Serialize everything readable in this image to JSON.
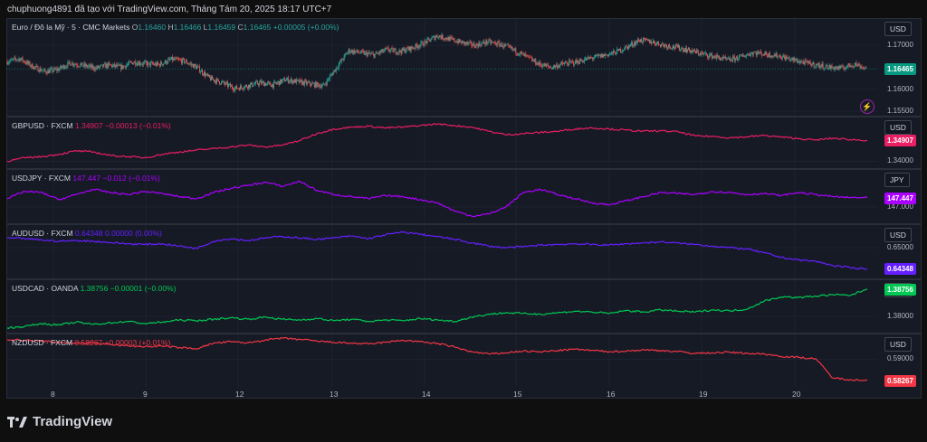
{
  "header": {
    "text": "chuphuong4891 đã tạo với TradingView.com, Tháng Tám 20, 2025 18:17 UTC+7"
  },
  "brand": {
    "name": "TradingView",
    "icon": "tradingview-logo-icon"
  },
  "colors": {
    "up": "#26a69a",
    "down": "#ef5350"
  },
  "x_axis": {
    "labels": [
      "8",
      "9",
      "12",
      "13",
      "14",
      "15",
      "16",
      "19",
      "20"
    ]
  },
  "chart_data": [
    {
      "type": "candlestick",
      "symbol": "Euro / Đô la Mỹ · 5 · CMC Markets",
      "ohlc": {
        "O": "1.16460",
        "H": "1.16466",
        "L": "1.16459",
        "C": "1.16465",
        "change": "+0.00005 (+0.00%)"
      },
      "currency": "USD",
      "last_price": "1.16465",
      "last_price_color": "#089981",
      "yticks": [
        "1.17000",
        "1.16000",
        "1.15500"
      ],
      "ylim": [
        1.154,
        1.176
      ],
      "points": [
        1.1663,
        1.167,
        1.1652,
        1.164,
        1.1645,
        1.166,
        1.1654,
        1.1648,
        1.1655,
        1.165,
        1.1662,
        1.1658,
        1.1656,
        1.1668,
        1.1664,
        1.165,
        1.1625,
        1.1615,
        1.1602,
        1.1608,
        1.1615,
        1.161,
        1.1622,
        1.1617,
        1.1612,
        1.1608,
        1.1648,
        1.1688,
        1.1683,
        1.1678,
        1.169,
        1.1686,
        1.1694,
        1.1706,
        1.1722,
        1.1714,
        1.1706,
        1.17,
        1.1708,
        1.1702,
        1.169,
        1.1675,
        1.1658,
        1.165,
        1.1658,
        1.1662,
        1.167,
        1.1676,
        1.1683,
        1.1696,
        1.1712,
        1.1708,
        1.17,
        1.1695,
        1.1688,
        1.168,
        1.1674,
        1.1666,
        1.1674,
        1.1684,
        1.168,
        1.1676,
        1.1668,
        1.1661,
        1.1655,
        1.165,
        1.1648,
        1.1658,
        1.16465
      ]
    },
    {
      "type": "line",
      "symbol": "GBPUSD · FXCM",
      "value_text": "1.34907  −0.00013 (−0.01%)",
      "color": "#e91e63",
      "currency": "USD",
      "last_price": "1.34907",
      "yticks": [
        "1.34000"
      ],
      "ylim": [
        1.337,
        1.359
      ],
      "points": [
        1.34,
        1.3415,
        1.342,
        1.343,
        1.3445,
        1.344,
        1.3425,
        1.342,
        1.3415,
        1.343,
        1.344,
        1.3448,
        1.3455,
        1.3462,
        1.347,
        1.3462,
        1.347,
        1.349,
        1.352,
        1.354,
        1.3548,
        1.3552,
        1.3545,
        1.3548,
        1.3555,
        1.3562,
        1.3555,
        1.3548,
        1.353,
        1.3515,
        1.352,
        1.3525,
        1.353,
        1.354,
        1.3545,
        1.354,
        1.3535,
        1.353,
        1.3532,
        1.3528,
        1.351,
        1.3508,
        1.3502,
        1.3506,
        1.3512,
        1.3505,
        1.3498,
        1.3492,
        1.35,
        1.3494,
        1.34907
      ]
    },
    {
      "type": "line",
      "symbol": "USDJPY · FXCM",
      "value_text": "147.447  −0.012 (−0.01%)",
      "color": "#aa00ff",
      "currency": "JPY",
      "last_price": "147.447",
      "yticks": [
        "147.000"
      ],
      "ylim": [
        146.2,
        148.8
      ],
      "points": [
        147.4,
        147.75,
        147.7,
        147.35,
        147.6,
        147.85,
        147.7,
        147.6,
        147.75,
        147.65,
        147.5,
        147.4,
        147.7,
        147.9,
        148.05,
        148.2,
        148.0,
        148.25,
        147.8,
        147.6,
        147.5,
        147.4,
        147.55,
        147.5,
        147.35,
        147.2,
        146.8,
        146.55,
        146.65,
        147.0,
        147.7,
        147.85,
        147.6,
        147.4,
        147.2,
        147.1,
        147.3,
        147.5,
        147.7,
        147.65,
        147.6,
        147.75,
        147.7,
        147.6,
        147.65,
        147.55,
        147.7,
        147.6,
        147.5,
        147.45,
        147.447
      ]
    },
    {
      "type": "line",
      "symbol": "AUDUSD · FXCM",
      "value_text": "0.64348  0.00000 (0.00%)",
      "color": "#651fff",
      "currency": "USD",
      "last_price": "0.64348",
      "yticks": [
        "0.65000"
      ],
      "ylim": [
        0.6405,
        0.657
      ],
      "points": [
        0.653,
        0.6528,
        0.6524,
        0.652,
        0.6522,
        0.652,
        0.6516,
        0.6512,
        0.651,
        0.6512,
        0.6505,
        0.6498,
        0.652,
        0.6528,
        0.6522,
        0.653,
        0.6535,
        0.653,
        0.6526,
        0.653,
        0.6536,
        0.6528,
        0.654,
        0.6548,
        0.6542,
        0.6534,
        0.6526,
        0.6515,
        0.6505,
        0.65,
        0.6503,
        0.6508,
        0.651,
        0.6512,
        0.651,
        0.6508,
        0.6512,
        0.6515,
        0.6518,
        0.6514,
        0.651,
        0.6505,
        0.65,
        0.6496,
        0.6484,
        0.647,
        0.6462,
        0.6458,
        0.6445,
        0.6438,
        0.64348
      ]
    },
    {
      "type": "line",
      "symbol": "USDCAD · OANDA",
      "value_text": "1.38756  −0.00001 (−0.00%)",
      "color": "#00c853",
      "currency": "CAD",
      "last_price": "1.38756",
      "yticks": [
        "1.38000"
      ],
      "ylim": [
        1.3755,
        1.39
      ],
      "points": [
        1.3768,
        1.3772,
        1.378,
        1.3776,
        1.3784,
        1.3778,
        1.3782,
        1.3786,
        1.378,
        1.3784,
        1.379,
        1.3788,
        1.3792,
        1.3796,
        1.3792,
        1.3798,
        1.3792,
        1.379,
        1.3794,
        1.3788,
        1.3792,
        1.3786,
        1.379,
        1.3788,
        1.3794,
        1.379,
        1.3786,
        1.3798,
        1.3806,
        1.381,
        1.3808,
        1.3806,
        1.381,
        1.3814,
        1.3812,
        1.3808,
        1.3816,
        1.3812,
        1.3818,
        1.3814,
        1.3812,
        1.3818,
        1.3815,
        1.382,
        1.3842,
        1.3854,
        1.3852,
        1.3856,
        1.386,
        1.3858,
        1.38756
      ]
    },
    {
      "type": "line",
      "symbol": "NZDUSD · FXCM",
      "value_text": "0.58267  +0.00003 (+0.01%)",
      "color": "#f23645",
      "currency": "USD",
      "last_price": "0.58267",
      "yticks": [
        "0.59000"
      ],
      "ylim": [
        0.5805,
        0.5985
      ],
      "points": [
        0.5968,
        0.5965,
        0.5962,
        0.5958,
        0.5955,
        0.5956,
        0.595,
        0.5946,
        0.5943,
        0.5945,
        0.594,
        0.5936,
        0.5955,
        0.596,
        0.5956,
        0.5966,
        0.5972,
        0.5968,
        0.5962,
        0.5958,
        0.5955,
        0.5952,
        0.5958,
        0.5965,
        0.596,
        0.5954,
        0.5942,
        0.5925,
        0.5918,
        0.5922,
        0.5928,
        0.5925,
        0.593,
        0.5934,
        0.593,
        0.5926,
        0.5928,
        0.5932,
        0.593,
        0.5926,
        0.592,
        0.5922,
        0.5924,
        0.592,
        0.5918,
        0.591,
        0.5906,
        0.5902,
        0.5835,
        0.583,
        0.58267
      ]
    }
  ]
}
